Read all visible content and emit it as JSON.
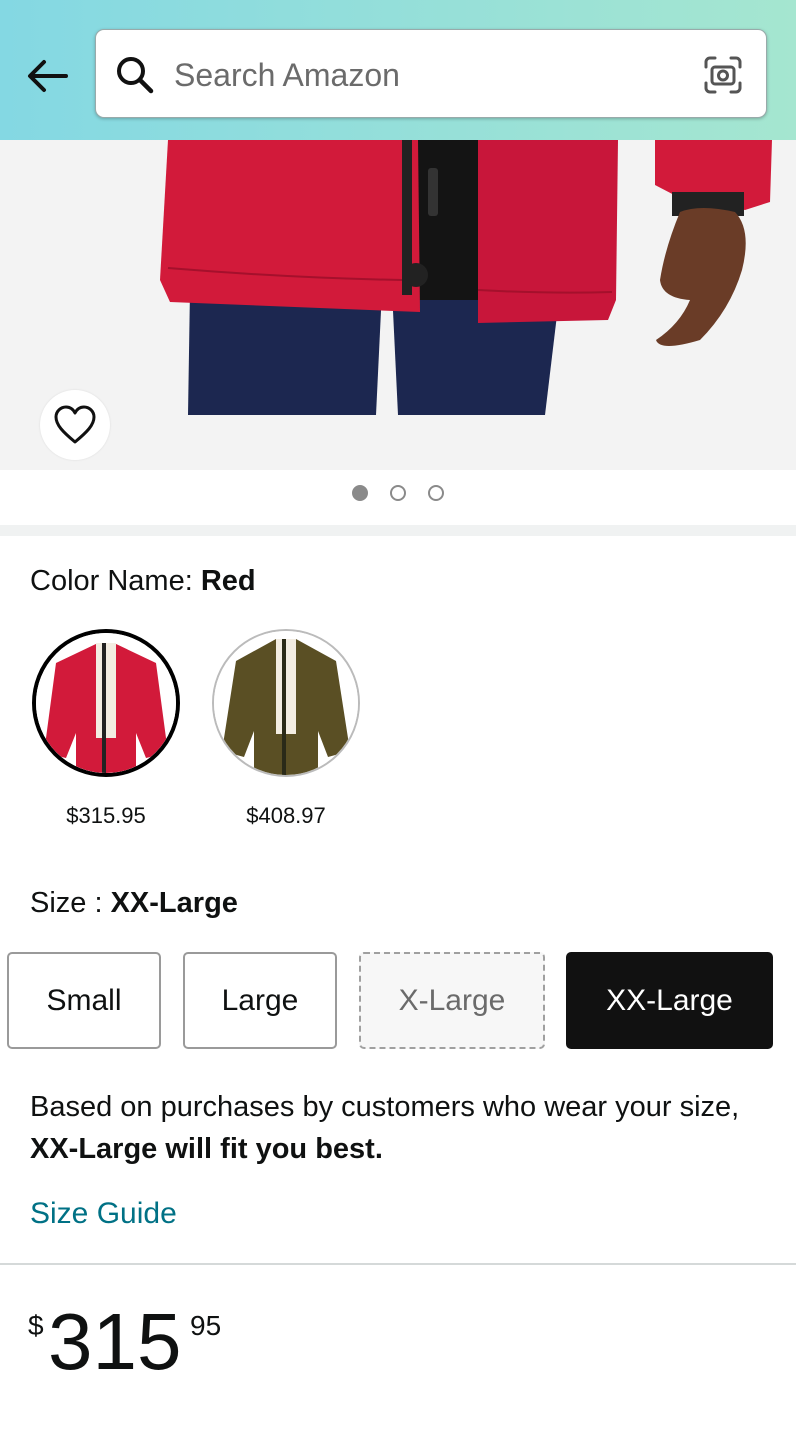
{
  "header": {
    "search": {
      "placeholder": "Search Amazon"
    },
    "icons": {
      "back": "arrow-left-icon",
      "search": "search-icon",
      "camera": "camera-scan-icon"
    },
    "colors": {
      "gradient_start": "#84d8e3",
      "gradient_end": "#a5e6d0"
    }
  },
  "product_image": {
    "wishlist_icon": "heart-outline-icon",
    "carousel": {
      "total": 3,
      "active": 1
    }
  },
  "color": {
    "label": "Color Name:",
    "selected": "Red",
    "options": [
      {
        "name": "Red",
        "price": "$315.95",
        "selected": true
      },
      {
        "name": "Olive",
        "price": "$408.97",
        "selected": false
      }
    ]
  },
  "size": {
    "label": "Size :",
    "selected": "XX-Large",
    "options": [
      {
        "label": "Small",
        "state": "available"
      },
      {
        "label": "Large",
        "state": "available"
      },
      {
        "label": "X-Large",
        "state": "unavailable"
      },
      {
        "label": "XX-Large",
        "state": "selected"
      }
    ],
    "fit_prefix": "Based on purchases by customers who wear your size,",
    "fit_bold": "XX-Large will fit you best.",
    "guide_link": "Size Guide"
  },
  "price": {
    "symbol": "$",
    "whole": "315",
    "fraction": "95"
  },
  "theme": {
    "link_color": "#007185",
    "selected_bg": "#111111"
  }
}
